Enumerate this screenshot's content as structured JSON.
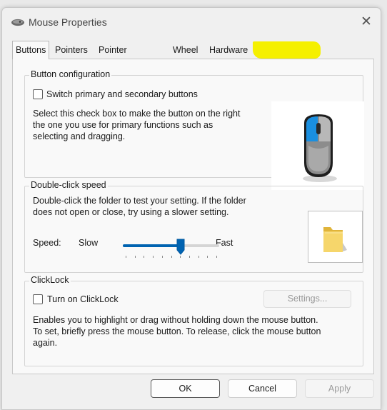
{
  "window": {
    "title": "Mouse Properties",
    "close_glyph": "✕"
  },
  "tabs": [
    {
      "label": "Buttons",
      "active": true
    },
    {
      "label": "Pointers",
      "active": false
    },
    {
      "label": "Pointer Options",
      "active": false
    },
    {
      "label": "Wheel",
      "active": false
    },
    {
      "label": "Hardware",
      "active": false
    }
  ],
  "button_config": {
    "title": "Button configuration",
    "checkbox_label": "Switch primary and secondary buttons",
    "checked": false,
    "description_lines": [
      "Select this check box to make the button on the right",
      "the one you use for primary functions such as",
      "selecting and dragging."
    ]
  },
  "double_click": {
    "title": "Double-click speed",
    "description_lines": [
      "Double-click the folder to test your setting. If the folder",
      "does not open or close, try using a slower setting."
    ],
    "speed_label": "Speed:",
    "slow_label": "Slow",
    "fast_label": "Fast",
    "slider_value_fraction": 0.6,
    "tick_count": 11
  },
  "clicklock": {
    "title": "ClickLock",
    "checkbox_label": "Turn on ClickLock",
    "checked": false,
    "settings_button": "Settings...",
    "description_lines": [
      "Enables you to highlight or drag without holding down the mouse button.",
      "To set, briefly press the mouse button. To release, click the mouse button",
      "again."
    ]
  },
  "buttons": {
    "ok": "OK",
    "cancel": "Cancel",
    "apply": "Apply"
  },
  "colors": {
    "accent": "#0063b1",
    "highlight": "#f5f000",
    "mouse_blue": "#1a8fe0"
  },
  "icons": [
    "mouse-icon",
    "mouse-illustration",
    "folder-icon",
    "close-icon",
    "checkbox-icon"
  ]
}
